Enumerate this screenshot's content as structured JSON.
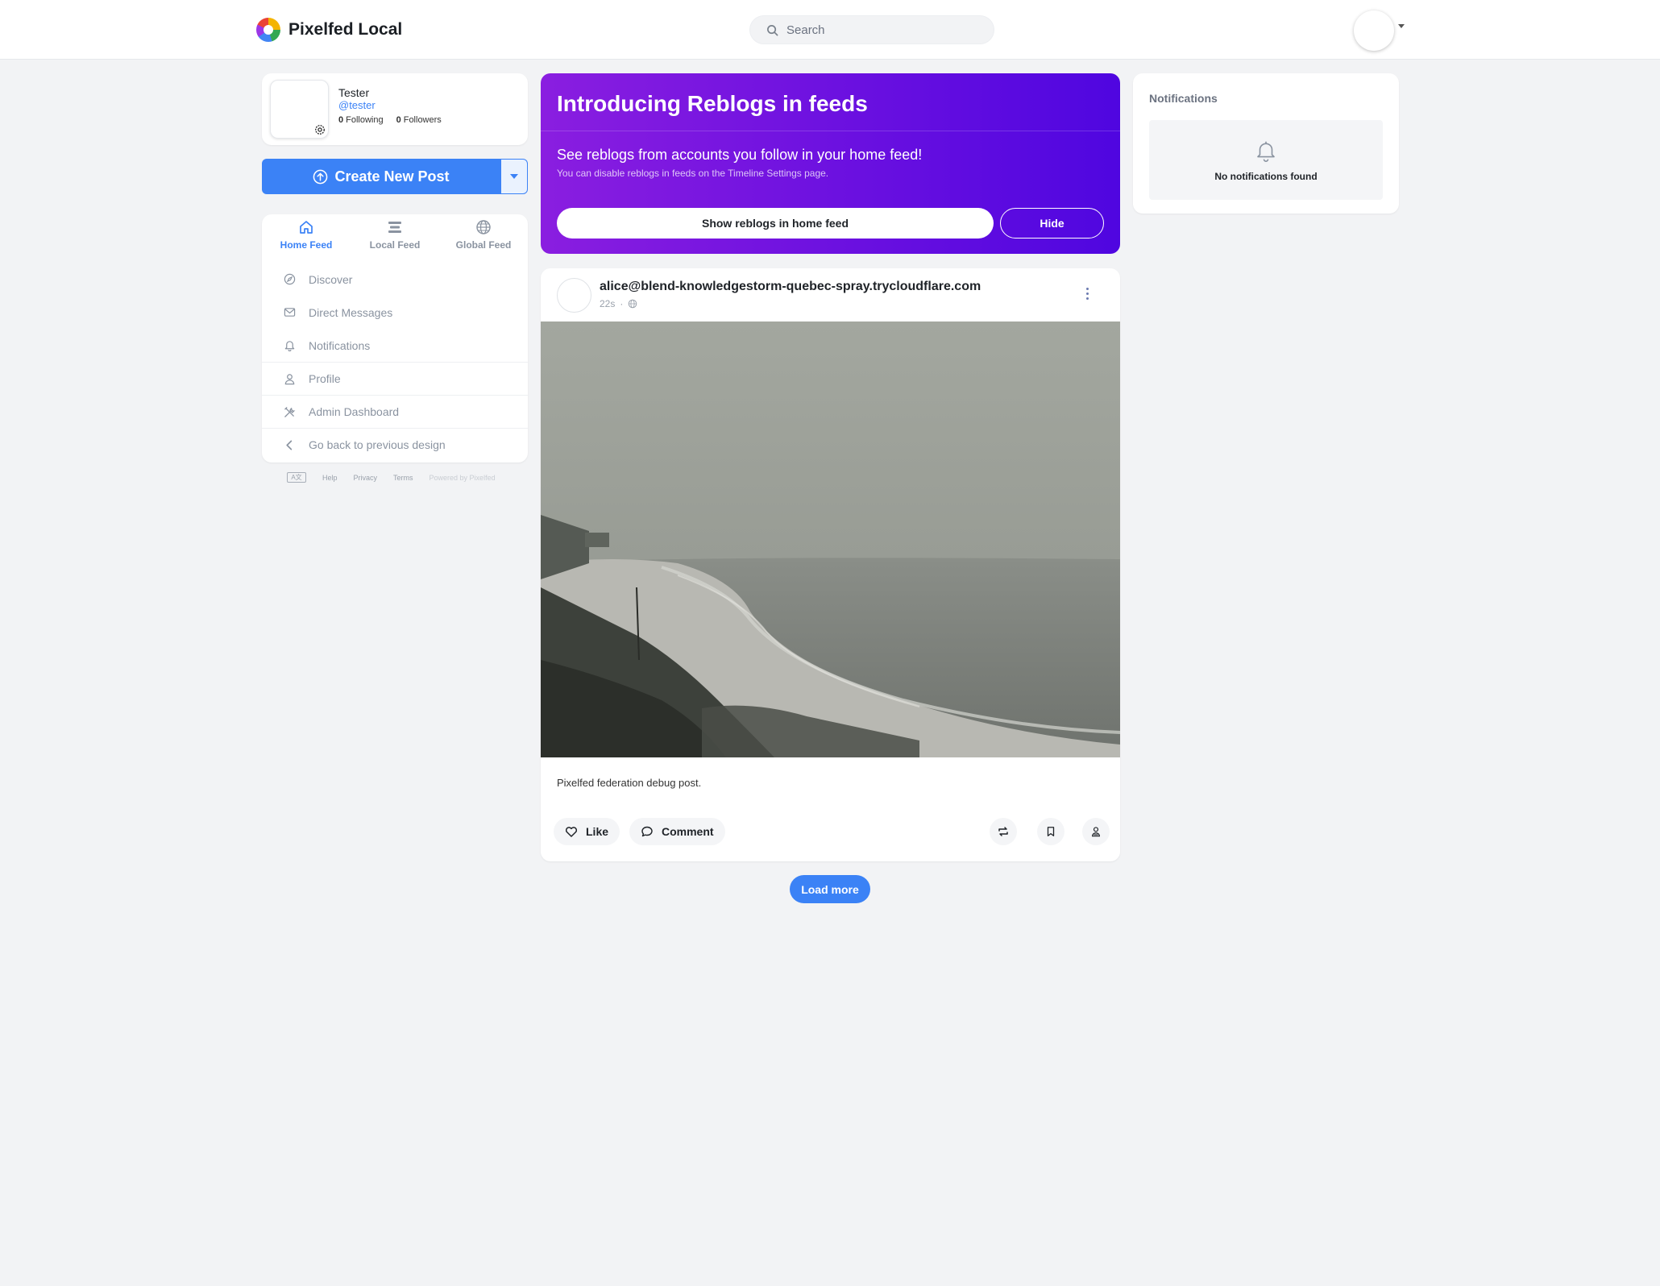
{
  "header": {
    "brand": "Pixelfed Local",
    "search_placeholder": "Search"
  },
  "profile": {
    "name": "Tester",
    "handle": "@tester",
    "following_count": "0",
    "following_label": "Following",
    "followers_count": "0",
    "followers_label": "Followers"
  },
  "create_post": {
    "label": "Create New Post"
  },
  "feed_tabs": [
    {
      "label": "Home Feed",
      "icon": "home-icon",
      "active": true
    },
    {
      "label": "Local Feed",
      "icon": "list-icon",
      "active": false
    },
    {
      "label": "Global Feed",
      "icon": "globe-icon",
      "active": false
    }
  ],
  "nav": [
    {
      "label": "Discover",
      "icon": "compass-icon"
    },
    {
      "label": "Direct Messages",
      "icon": "mail-icon"
    },
    {
      "label": "Notifications",
      "icon": "bell-icon"
    },
    {
      "label": "Profile",
      "icon": "user-icon"
    },
    {
      "label": "Admin Dashboard",
      "icon": "tools-icon"
    },
    {
      "label": "Go back to previous design",
      "icon": "chevron-left-icon"
    }
  ],
  "footer": {
    "lang": "A文",
    "help": "Help",
    "privacy": "Privacy",
    "terms": "Terms",
    "powered": "Powered by Pixelfed"
  },
  "banner": {
    "title": "Introducing Reblogs in feeds",
    "subtitle": "See reblogs from accounts you follow in your home feed!",
    "note": "You can disable reblogs in feeds on the Timeline Settings page.",
    "show_button": "Show reblogs in home feed",
    "hide_button": "Hide"
  },
  "post": {
    "username": "alice@blend-knowledgestorm-quebec-spray.trycloudflare.com",
    "time": "22s",
    "separator": "·",
    "caption": "Pixelfed federation debug post.",
    "like_label": "Like",
    "comment_label": "Comment"
  },
  "load_more": "Load more",
  "notifications": {
    "title": "Notifications",
    "empty_text": "No notifications found"
  },
  "colors": {
    "accent": "#3b82f6",
    "banner_start": "#8a1ee0",
    "banner_end": "#4f06e0",
    "background": "#f2f3f5"
  }
}
